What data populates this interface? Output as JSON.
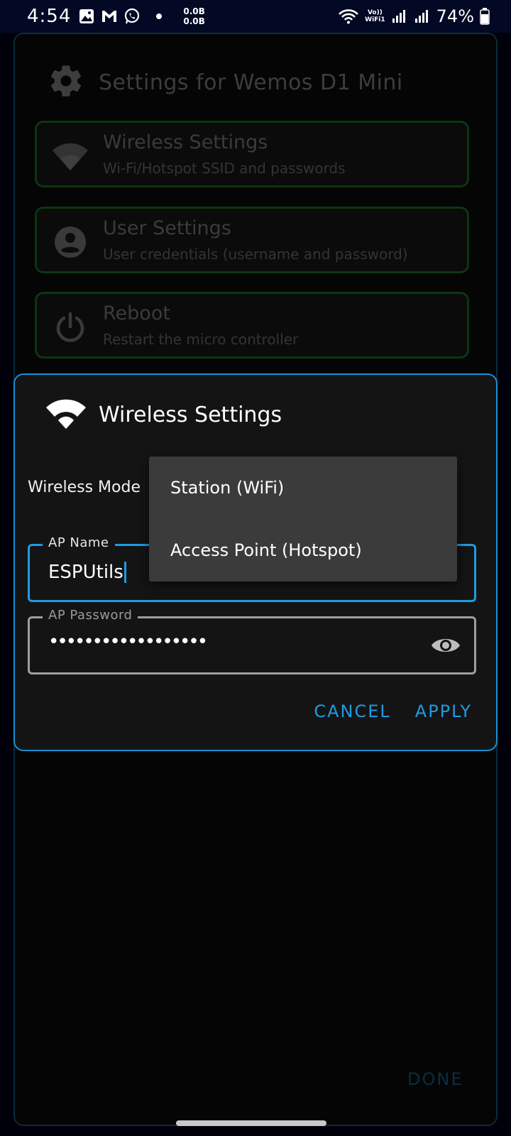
{
  "status_bar": {
    "time": "4:54",
    "net_up": "0.0B",
    "net_down": "0.0B",
    "volte_top": "Vo))",
    "volte_bottom": "WiFi1",
    "battery": "74%"
  },
  "page": {
    "title": "Settings for Wemos D1 Mini",
    "items": [
      {
        "icon": "wifi-icon",
        "title": "Wireless Settings",
        "subtitle": "Wi-Fi/Hotspot SSID and passwords"
      },
      {
        "icon": "account-icon",
        "title": "User Settings",
        "subtitle": "User credentials (username and password)"
      },
      {
        "icon": "power-icon",
        "title": "Reboot",
        "subtitle": "Restart the micro controller"
      }
    ],
    "done_label": "DONE"
  },
  "dialog": {
    "title": "Wireless Settings",
    "mode_label": "Wireless Mode",
    "ap_name_label": "AP Name",
    "ap_name_value": "ESPUtils",
    "ap_password_label": "AP Password",
    "ap_password_dots": "••••••••••••••••••",
    "cancel_label": "CANCEL",
    "apply_label": "APPLY"
  },
  "dropdown": {
    "options": [
      "Station (WiFi)",
      "Access Point (Hotspot)"
    ]
  },
  "colors": {
    "accent": "#1f9be3",
    "card_border": "#0d3510",
    "background": "#050505"
  }
}
